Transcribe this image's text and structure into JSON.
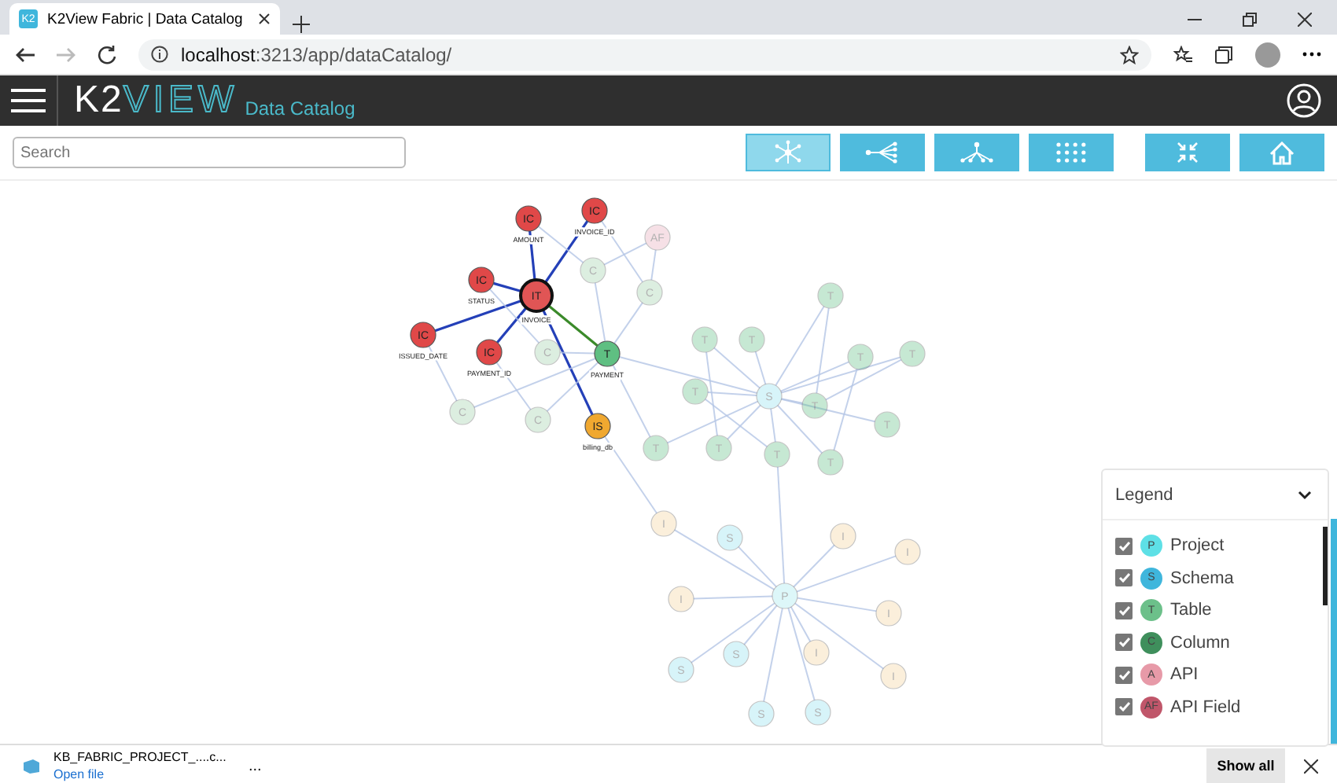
{
  "browser": {
    "tab": {
      "favicon": "K2",
      "title": "K2View Fabric | Data Catalog"
    },
    "url_host": "localhost",
    "url_path": ":3213/app/dataCatalog/"
  },
  "header": {
    "logo_main": "K2",
    "logo_accent": "VIEW",
    "subtitle": "Data Catalog"
  },
  "search": {
    "placeholder": "Search"
  },
  "view_buttons": [
    {
      "kind": "star",
      "selected": true
    },
    {
      "kind": "tree-left",
      "selected": false
    },
    {
      "kind": "tree-down",
      "selected": false
    },
    {
      "kind": "grid",
      "selected": false
    }
  ],
  "graph": {
    "nodes": [
      {
        "letter": "IC",
        "label": "AMOUNT",
        "kind": "invoice-column",
        "highlighted": true
      },
      {
        "letter": "IC",
        "label": "INVOICE_ID",
        "kind": "invoice-column",
        "highlighted": true
      },
      {
        "letter": "AF",
        "kind": "api-field",
        "highlighted": false
      },
      {
        "letter": "IC",
        "label": "STATUS",
        "kind": "invoice-column",
        "highlighted": true
      },
      {
        "letter": "IT",
        "label": "INVOICE",
        "kind": "invoice-table",
        "highlighted": true
      },
      {
        "letter": "C",
        "kind": "column",
        "highlighted": false
      },
      {
        "letter": "C",
        "kind": "column",
        "highlighted": false
      },
      {
        "letter": "T",
        "kind": "table",
        "highlighted": false
      },
      {
        "letter": "IC",
        "label": "ISSUED_DATE",
        "kind": "invoice-column",
        "highlighted": true
      },
      {
        "letter": "T",
        "kind": "table",
        "highlighted": false
      },
      {
        "letter": "T",
        "kind": "table",
        "highlighted": false
      },
      {
        "letter": "IC",
        "label": "PAYMENT_ID",
        "kind": "invoice-column",
        "highlighted": true
      },
      {
        "letter": "C",
        "kind": "column",
        "highlighted": false
      },
      {
        "letter": "T",
        "label": "PAYMENT",
        "kind": "table",
        "highlighted": true
      },
      {
        "letter": "T",
        "kind": "table",
        "highlighted": false
      },
      {
        "letter": "T",
        "kind": "table",
        "highlighted": false
      },
      {
        "letter": "C",
        "kind": "column",
        "highlighted": false
      },
      {
        "letter": "C",
        "kind": "column",
        "highlighted": false
      },
      {
        "letter": "IS",
        "label": "billing_db",
        "kind": "invoice-schema",
        "highlighted": true
      },
      {
        "letter": "T",
        "kind": "table",
        "highlighted": false
      },
      {
        "letter": "S",
        "kind": "schema",
        "highlighted": false
      },
      {
        "letter": "T",
        "kind": "table",
        "highlighted": false
      },
      {
        "letter": "T",
        "kind": "table",
        "highlighted": false
      },
      {
        "letter": "T",
        "kind": "table",
        "highlighted": false
      },
      {
        "letter": "T",
        "kind": "table",
        "highlighted": false
      },
      {
        "letter": "T",
        "kind": "table",
        "highlighted": false
      },
      {
        "letter": "T",
        "kind": "table",
        "highlighted": false
      },
      {
        "letter": "I",
        "kind": "interface",
        "highlighted": false
      },
      {
        "letter": "S",
        "kind": "schema",
        "highlighted": false
      },
      {
        "letter": "I",
        "kind": "interface",
        "highlighted": false
      },
      {
        "letter": "I",
        "kind": "interface",
        "highlighted": false
      },
      {
        "letter": "I",
        "kind": "interface",
        "highlighted": false
      },
      {
        "letter": "P",
        "kind": "project",
        "highlighted": false
      },
      {
        "letter": "I",
        "kind": "interface",
        "highlighted": false
      },
      {
        "letter": "S",
        "kind": "schema",
        "highlighted": false
      },
      {
        "letter": "I",
        "kind": "interface",
        "highlighted": false
      },
      {
        "letter": "S",
        "kind": "schema",
        "highlighted": false
      },
      {
        "letter": "I",
        "kind": "interface",
        "highlighted": false
      },
      {
        "letter": "S",
        "kind": "schema",
        "highlighted": false
      },
      {
        "letter": "S",
        "kind": "schema",
        "highlighted": false
      }
    ]
  },
  "legend": {
    "title": "Legend",
    "items": [
      {
        "letter": "P",
        "label": "Project",
        "checked": true,
        "color": "#5ee0e6"
      },
      {
        "letter": "S",
        "label": "Schema",
        "checked": true,
        "color": "#3fb6dc"
      },
      {
        "letter": "T",
        "label": "Table",
        "checked": true,
        "color": "#6cc08a"
      },
      {
        "letter": "C",
        "label": "Column",
        "checked": true,
        "color": "#3f8f5c"
      },
      {
        "letter": "A",
        "label": "API",
        "checked": true,
        "color": "#e79aa8"
      },
      {
        "letter": "AF",
        "label": "API Field",
        "checked": true,
        "color": "#c0566a"
      }
    ]
  },
  "download": {
    "file": "KB_FABRIC_PROJECT_....c...",
    "action": "Open file",
    "more": "...",
    "show_all": "Show all"
  }
}
